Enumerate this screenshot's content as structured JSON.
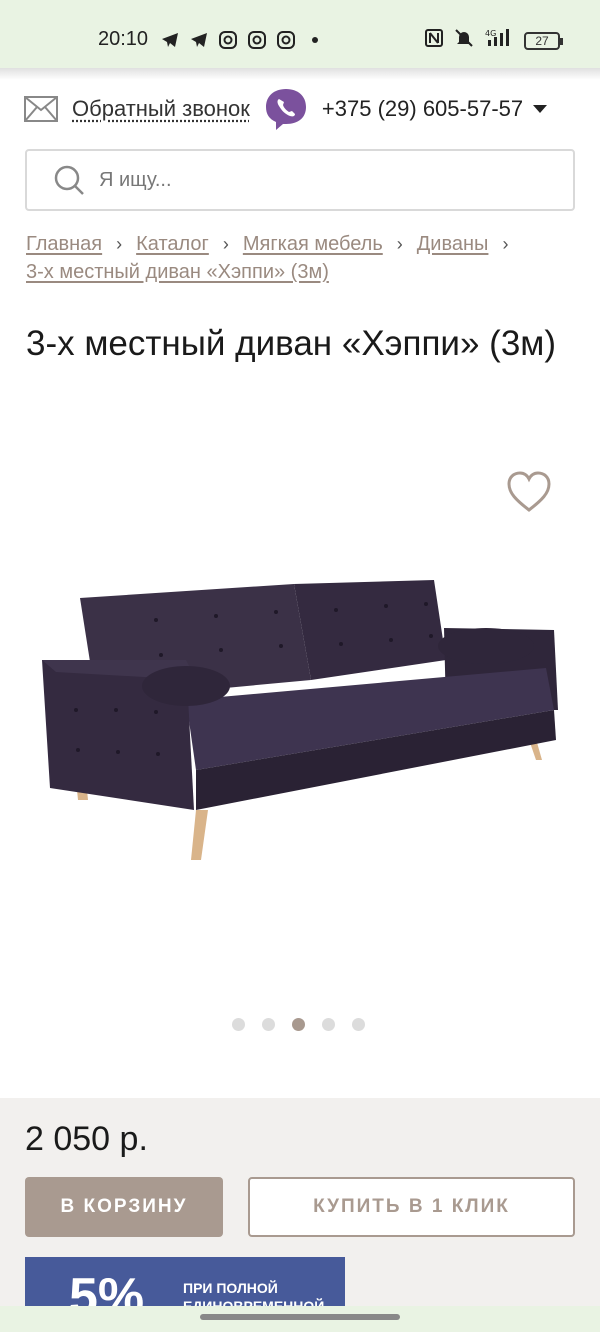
{
  "status_bar": {
    "time": "20:10",
    "battery": "27",
    "left_icons": [
      "telegram-icon",
      "telegram-icon",
      "instagram-icon",
      "instagram-icon",
      "instagram-icon",
      "dot-icon"
    ],
    "right_icons": [
      "nfc-icon",
      "mute-icon",
      "signal-4g-icon",
      "battery-icon"
    ]
  },
  "header": {
    "callback_label": "Обратный звонок",
    "phone": "+375 (29) 605-57-57"
  },
  "search": {
    "placeholder": "Я ищу..."
  },
  "breadcrumb": {
    "items": [
      "Главная",
      "Каталог",
      "Мягкая мебель",
      "Диваны",
      "3-х местный диван «Хэппи» (3м)"
    ]
  },
  "product": {
    "title": "3-х местный диван «Хэппи» (3м)",
    "image_slide_count": 5,
    "active_slide": 3,
    "price": "2 050 р.",
    "cart_button": "В КОРЗИНУ",
    "oneclick_button": "КУПИТЬ В 1 КЛИК"
  },
  "promo": {
    "big_text": "5%",
    "line1": "ПРИ ПОЛНОЙ",
    "line2": "ЕДИНОВРЕМЕННОЙ"
  },
  "colors": {
    "accent": "#a99a90",
    "status_bar_bg": "#e9f3e3",
    "panel_bg": "#f2f0ee",
    "promo_bg": "#475a9a",
    "viber": "#7b519d"
  }
}
